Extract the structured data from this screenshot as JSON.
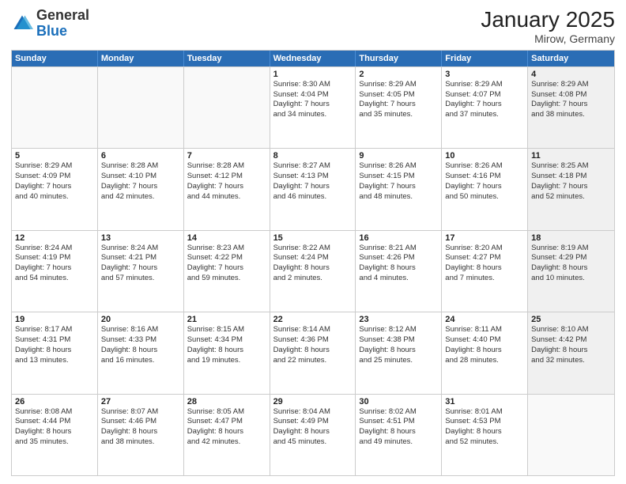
{
  "header": {
    "logo_general": "General",
    "logo_blue": "Blue",
    "title": "January 2025",
    "subtitle": "Mirow, Germany"
  },
  "weekdays": [
    "Sunday",
    "Monday",
    "Tuesday",
    "Wednesday",
    "Thursday",
    "Friday",
    "Saturday"
  ],
  "weeks": [
    [
      {
        "day": "",
        "lines": [],
        "empty": true
      },
      {
        "day": "",
        "lines": [],
        "empty": true
      },
      {
        "day": "",
        "lines": [],
        "empty": true
      },
      {
        "day": "1",
        "lines": [
          "Sunrise: 8:30 AM",
          "Sunset: 4:04 PM",
          "Daylight: 7 hours",
          "and 34 minutes."
        ],
        "empty": false
      },
      {
        "day": "2",
        "lines": [
          "Sunrise: 8:29 AM",
          "Sunset: 4:05 PM",
          "Daylight: 7 hours",
          "and 35 minutes."
        ],
        "empty": false
      },
      {
        "day": "3",
        "lines": [
          "Sunrise: 8:29 AM",
          "Sunset: 4:07 PM",
          "Daylight: 7 hours",
          "and 37 minutes."
        ],
        "empty": false
      },
      {
        "day": "4",
        "lines": [
          "Sunrise: 8:29 AM",
          "Sunset: 4:08 PM",
          "Daylight: 7 hours",
          "and 38 minutes."
        ],
        "empty": false,
        "shaded": true
      }
    ],
    [
      {
        "day": "5",
        "lines": [
          "Sunrise: 8:29 AM",
          "Sunset: 4:09 PM",
          "Daylight: 7 hours",
          "and 40 minutes."
        ],
        "empty": false
      },
      {
        "day": "6",
        "lines": [
          "Sunrise: 8:28 AM",
          "Sunset: 4:10 PM",
          "Daylight: 7 hours",
          "and 42 minutes."
        ],
        "empty": false
      },
      {
        "day": "7",
        "lines": [
          "Sunrise: 8:28 AM",
          "Sunset: 4:12 PM",
          "Daylight: 7 hours",
          "and 44 minutes."
        ],
        "empty": false
      },
      {
        "day": "8",
        "lines": [
          "Sunrise: 8:27 AM",
          "Sunset: 4:13 PM",
          "Daylight: 7 hours",
          "and 46 minutes."
        ],
        "empty": false
      },
      {
        "day": "9",
        "lines": [
          "Sunrise: 8:26 AM",
          "Sunset: 4:15 PM",
          "Daylight: 7 hours",
          "and 48 minutes."
        ],
        "empty": false
      },
      {
        "day": "10",
        "lines": [
          "Sunrise: 8:26 AM",
          "Sunset: 4:16 PM",
          "Daylight: 7 hours",
          "and 50 minutes."
        ],
        "empty": false
      },
      {
        "day": "11",
        "lines": [
          "Sunrise: 8:25 AM",
          "Sunset: 4:18 PM",
          "Daylight: 7 hours",
          "and 52 minutes."
        ],
        "empty": false,
        "shaded": true
      }
    ],
    [
      {
        "day": "12",
        "lines": [
          "Sunrise: 8:24 AM",
          "Sunset: 4:19 PM",
          "Daylight: 7 hours",
          "and 54 minutes."
        ],
        "empty": false
      },
      {
        "day": "13",
        "lines": [
          "Sunrise: 8:24 AM",
          "Sunset: 4:21 PM",
          "Daylight: 7 hours",
          "and 57 minutes."
        ],
        "empty": false
      },
      {
        "day": "14",
        "lines": [
          "Sunrise: 8:23 AM",
          "Sunset: 4:22 PM",
          "Daylight: 7 hours",
          "and 59 minutes."
        ],
        "empty": false
      },
      {
        "day": "15",
        "lines": [
          "Sunrise: 8:22 AM",
          "Sunset: 4:24 PM",
          "Daylight: 8 hours",
          "and 2 minutes."
        ],
        "empty": false
      },
      {
        "day": "16",
        "lines": [
          "Sunrise: 8:21 AM",
          "Sunset: 4:26 PM",
          "Daylight: 8 hours",
          "and 4 minutes."
        ],
        "empty": false
      },
      {
        "day": "17",
        "lines": [
          "Sunrise: 8:20 AM",
          "Sunset: 4:27 PM",
          "Daylight: 8 hours",
          "and 7 minutes."
        ],
        "empty": false
      },
      {
        "day": "18",
        "lines": [
          "Sunrise: 8:19 AM",
          "Sunset: 4:29 PM",
          "Daylight: 8 hours",
          "and 10 minutes."
        ],
        "empty": false,
        "shaded": true
      }
    ],
    [
      {
        "day": "19",
        "lines": [
          "Sunrise: 8:17 AM",
          "Sunset: 4:31 PM",
          "Daylight: 8 hours",
          "and 13 minutes."
        ],
        "empty": false
      },
      {
        "day": "20",
        "lines": [
          "Sunrise: 8:16 AM",
          "Sunset: 4:33 PM",
          "Daylight: 8 hours",
          "and 16 minutes."
        ],
        "empty": false
      },
      {
        "day": "21",
        "lines": [
          "Sunrise: 8:15 AM",
          "Sunset: 4:34 PM",
          "Daylight: 8 hours",
          "and 19 minutes."
        ],
        "empty": false
      },
      {
        "day": "22",
        "lines": [
          "Sunrise: 8:14 AM",
          "Sunset: 4:36 PM",
          "Daylight: 8 hours",
          "and 22 minutes."
        ],
        "empty": false
      },
      {
        "day": "23",
        "lines": [
          "Sunrise: 8:12 AM",
          "Sunset: 4:38 PM",
          "Daylight: 8 hours",
          "and 25 minutes."
        ],
        "empty": false
      },
      {
        "day": "24",
        "lines": [
          "Sunrise: 8:11 AM",
          "Sunset: 4:40 PM",
          "Daylight: 8 hours",
          "and 28 minutes."
        ],
        "empty": false
      },
      {
        "day": "25",
        "lines": [
          "Sunrise: 8:10 AM",
          "Sunset: 4:42 PM",
          "Daylight: 8 hours",
          "and 32 minutes."
        ],
        "empty": false,
        "shaded": true
      }
    ],
    [
      {
        "day": "26",
        "lines": [
          "Sunrise: 8:08 AM",
          "Sunset: 4:44 PM",
          "Daylight: 8 hours",
          "and 35 minutes."
        ],
        "empty": false
      },
      {
        "day": "27",
        "lines": [
          "Sunrise: 8:07 AM",
          "Sunset: 4:46 PM",
          "Daylight: 8 hours",
          "and 38 minutes."
        ],
        "empty": false
      },
      {
        "day": "28",
        "lines": [
          "Sunrise: 8:05 AM",
          "Sunset: 4:47 PM",
          "Daylight: 8 hours",
          "and 42 minutes."
        ],
        "empty": false
      },
      {
        "day": "29",
        "lines": [
          "Sunrise: 8:04 AM",
          "Sunset: 4:49 PM",
          "Daylight: 8 hours",
          "and 45 minutes."
        ],
        "empty": false
      },
      {
        "day": "30",
        "lines": [
          "Sunrise: 8:02 AM",
          "Sunset: 4:51 PM",
          "Daylight: 8 hours",
          "and 49 minutes."
        ],
        "empty": false
      },
      {
        "day": "31",
        "lines": [
          "Sunrise: 8:01 AM",
          "Sunset: 4:53 PM",
          "Daylight: 8 hours",
          "and 52 minutes."
        ],
        "empty": false
      },
      {
        "day": "",
        "lines": [],
        "empty": true,
        "shaded": true
      }
    ]
  ]
}
